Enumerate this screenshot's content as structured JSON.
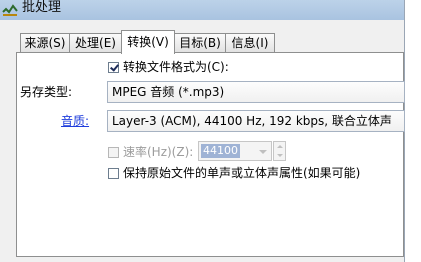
{
  "window": {
    "title": "批处理"
  },
  "tabs": [
    {
      "label": "来源(S)",
      "active": false
    },
    {
      "label": "处理(E)",
      "active": false
    },
    {
      "label": "转换(V)",
      "active": true
    },
    {
      "label": "目标(B)",
      "active": false
    },
    {
      "label": "信息(I)",
      "active": false
    }
  ],
  "convert": {
    "convert_format_label": "转换文件格式为(C):",
    "convert_format_checked": true,
    "save_type_label": "另存类型:",
    "save_type_value": "MPEG 音频 (*.mp3)",
    "quality_label": "音质:",
    "quality_value": "Layer-3 (ACM), 44100 Hz, 192 kbps, 联合立体声",
    "rate_label": "速率(Hz)(Z):",
    "rate_value": "44100",
    "rate_enabled": false,
    "keep_channels_label": "保持原始文件的单声或立体声属性(如果可能)",
    "keep_channels_checked": false
  }
}
